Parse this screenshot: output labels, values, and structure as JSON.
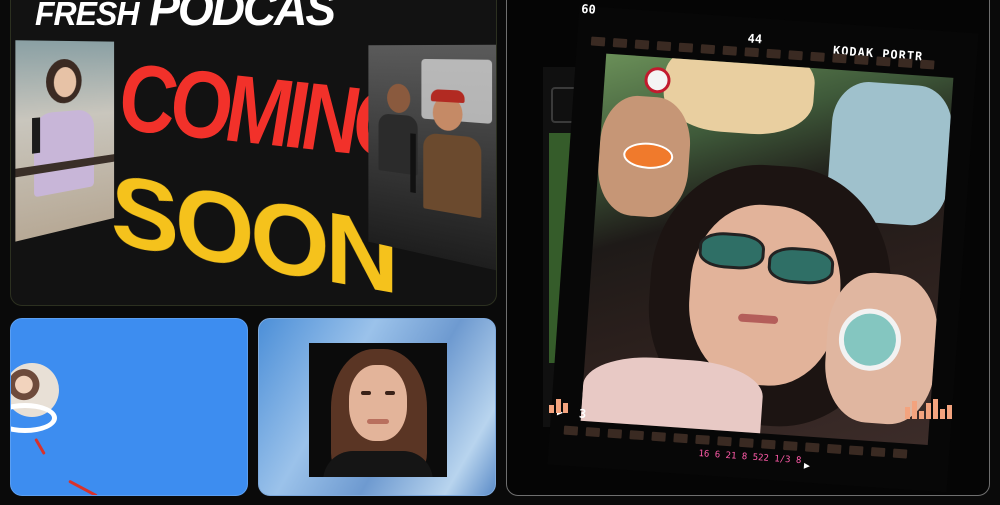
{
  "podcast_card": {
    "headline_small": "FRESH",
    "headline_big": "PODCAS",
    "coming": "COMING",
    "soon": "SOON",
    "panels": [
      "host-photo",
      "guests-photo"
    ]
  },
  "blue_card": {
    "shapes": [
      "mini-avatar",
      "white-ring",
      "red-strokes"
    ]
  },
  "portrait_card": {
    "image": "woman-portrait"
  },
  "film_card": {
    "frame_left_number": "60",
    "frame_top_number": "44",
    "brand": "KODAK PORTR",
    "frame_bottom_number": "3",
    "bottom_code": "16 6 21 8 522 1/3 8",
    "arrow_icon": "triangle-right-icon"
  },
  "colors": {
    "background": "#0a0a0a",
    "coming_red": "#f2312a",
    "soon_yellow": "#f5c21c",
    "blue_card": "#3d8df0",
    "film_pink": "#ff5aa8"
  }
}
